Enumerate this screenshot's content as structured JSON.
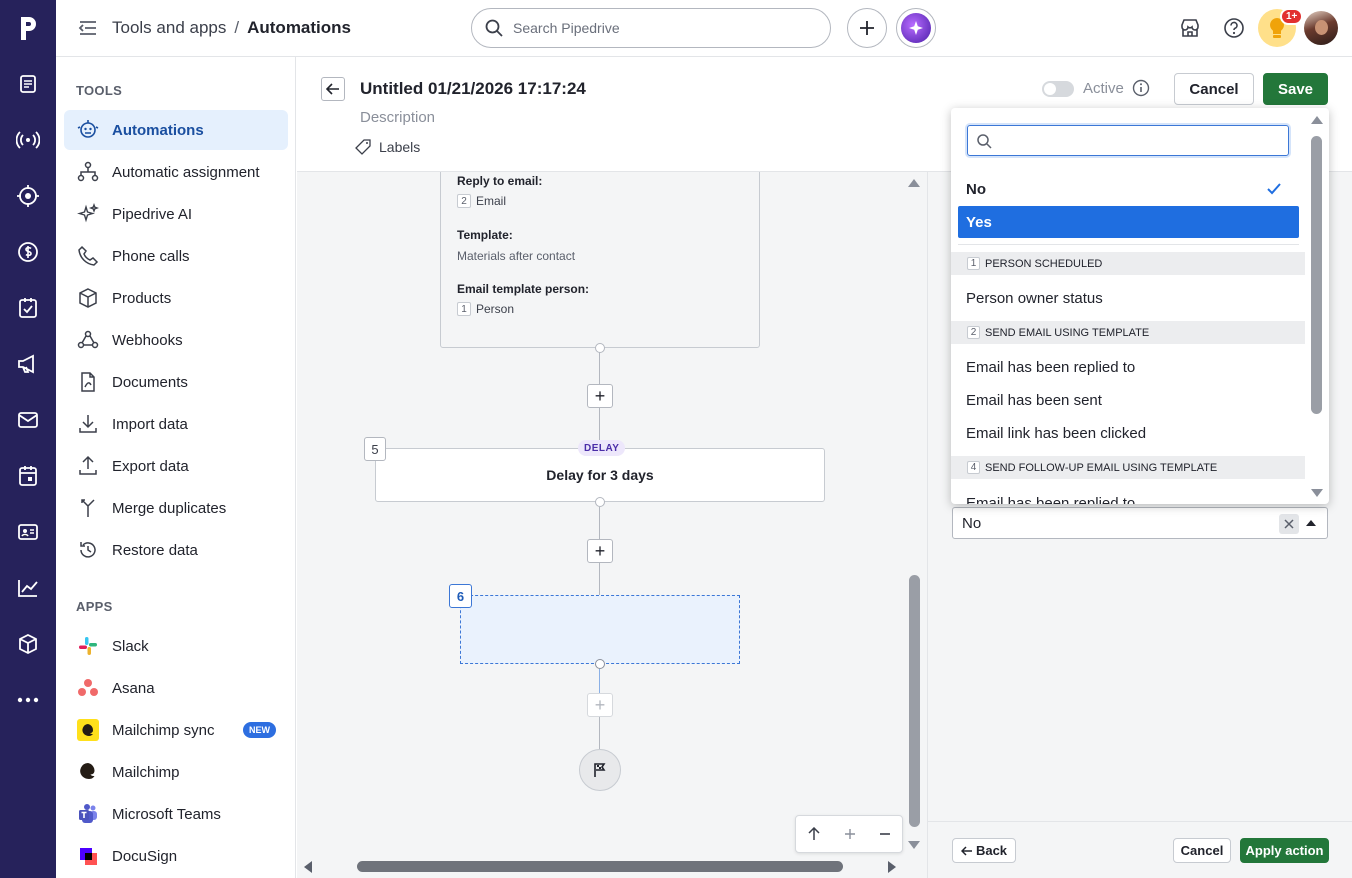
{
  "topbar": {
    "breadcrumb_parent": "Tools and apps",
    "breadcrumb_sep": "/",
    "breadcrumb_current": "Automations",
    "search_placeholder": "Search Pipedrive",
    "notification_count": "1+"
  },
  "sidebar": {
    "tools_heading": "TOOLS",
    "tools": [
      {
        "label": "Automations",
        "icon": "automation-robot-icon"
      },
      {
        "label": "Automatic assignment",
        "icon": "assignment-icon"
      },
      {
        "label": "Pipedrive AI",
        "icon": "sparkle-icon"
      },
      {
        "label": "Phone calls",
        "icon": "phone-icon"
      },
      {
        "label": "Products",
        "icon": "box-icon"
      },
      {
        "label": "Webhooks",
        "icon": "webhook-icon"
      },
      {
        "label": "Documents",
        "icon": "document-icon"
      },
      {
        "label": "Import data",
        "icon": "import-icon"
      },
      {
        "label": "Export data",
        "icon": "export-icon"
      },
      {
        "label": "Merge duplicates",
        "icon": "merge-icon"
      },
      {
        "label": "Restore data",
        "icon": "restore-icon"
      }
    ],
    "apps_heading": "APPS",
    "apps": [
      {
        "label": "Slack",
        "icon": "slack-icon"
      },
      {
        "label": "Asana",
        "icon": "asana-icon"
      },
      {
        "label": "Mailchimp sync",
        "icon": "mailchimp-icon",
        "badge": "NEW"
      },
      {
        "label": "Mailchimp",
        "icon": "mailchimp-icon"
      },
      {
        "label": "Microsoft Teams",
        "icon": "teams-icon"
      },
      {
        "label": "DocuSign",
        "icon": "docusign-icon"
      }
    ]
  },
  "editor": {
    "title": "Untitled 01/21/2026 17:17:24",
    "description_placeholder": "Description",
    "labels": "Labels",
    "active_label": "Active",
    "active": false,
    "cancel": "Cancel",
    "save": "Save"
  },
  "canvas": {
    "email_card": {
      "reply_label": "Reply to email:",
      "reply_num": "2",
      "reply_value": "Email",
      "template_label": "Template:",
      "template_value": "Materials after contact",
      "person_label": "Email template person:",
      "person_num": "1",
      "person_value": "Person"
    },
    "delay_step": {
      "num": "5",
      "tag": "DELAY",
      "text": "Delay for 3 days"
    },
    "new_step": {
      "num": "6"
    }
  },
  "dropdown": {
    "search_placeholder": "",
    "options": [
      {
        "label": "No",
        "checked": true
      },
      {
        "label": "Yes",
        "highlighted": true
      }
    ],
    "groups": [
      {
        "num": "1",
        "label": "PERSON SCHEDULED",
        "items": [
          "Person owner status"
        ]
      },
      {
        "num": "2",
        "label": "SEND EMAIL USING TEMPLATE",
        "items": [
          "Email has been replied to",
          "Email has been sent",
          "Email link has been clicked"
        ]
      },
      {
        "num": "4",
        "label": "SEND FOLLOW-UP EMAIL USING TEMPLATE",
        "items": [
          "Email has been replied to"
        ]
      }
    ]
  },
  "panel": {
    "select_value": "No",
    "back": "Back",
    "cancel": "Cancel",
    "apply": "Apply action"
  },
  "colors": {
    "nav_bg": "#26225b",
    "accent_blue": "#1f6ee0",
    "save_green": "#23773a"
  }
}
